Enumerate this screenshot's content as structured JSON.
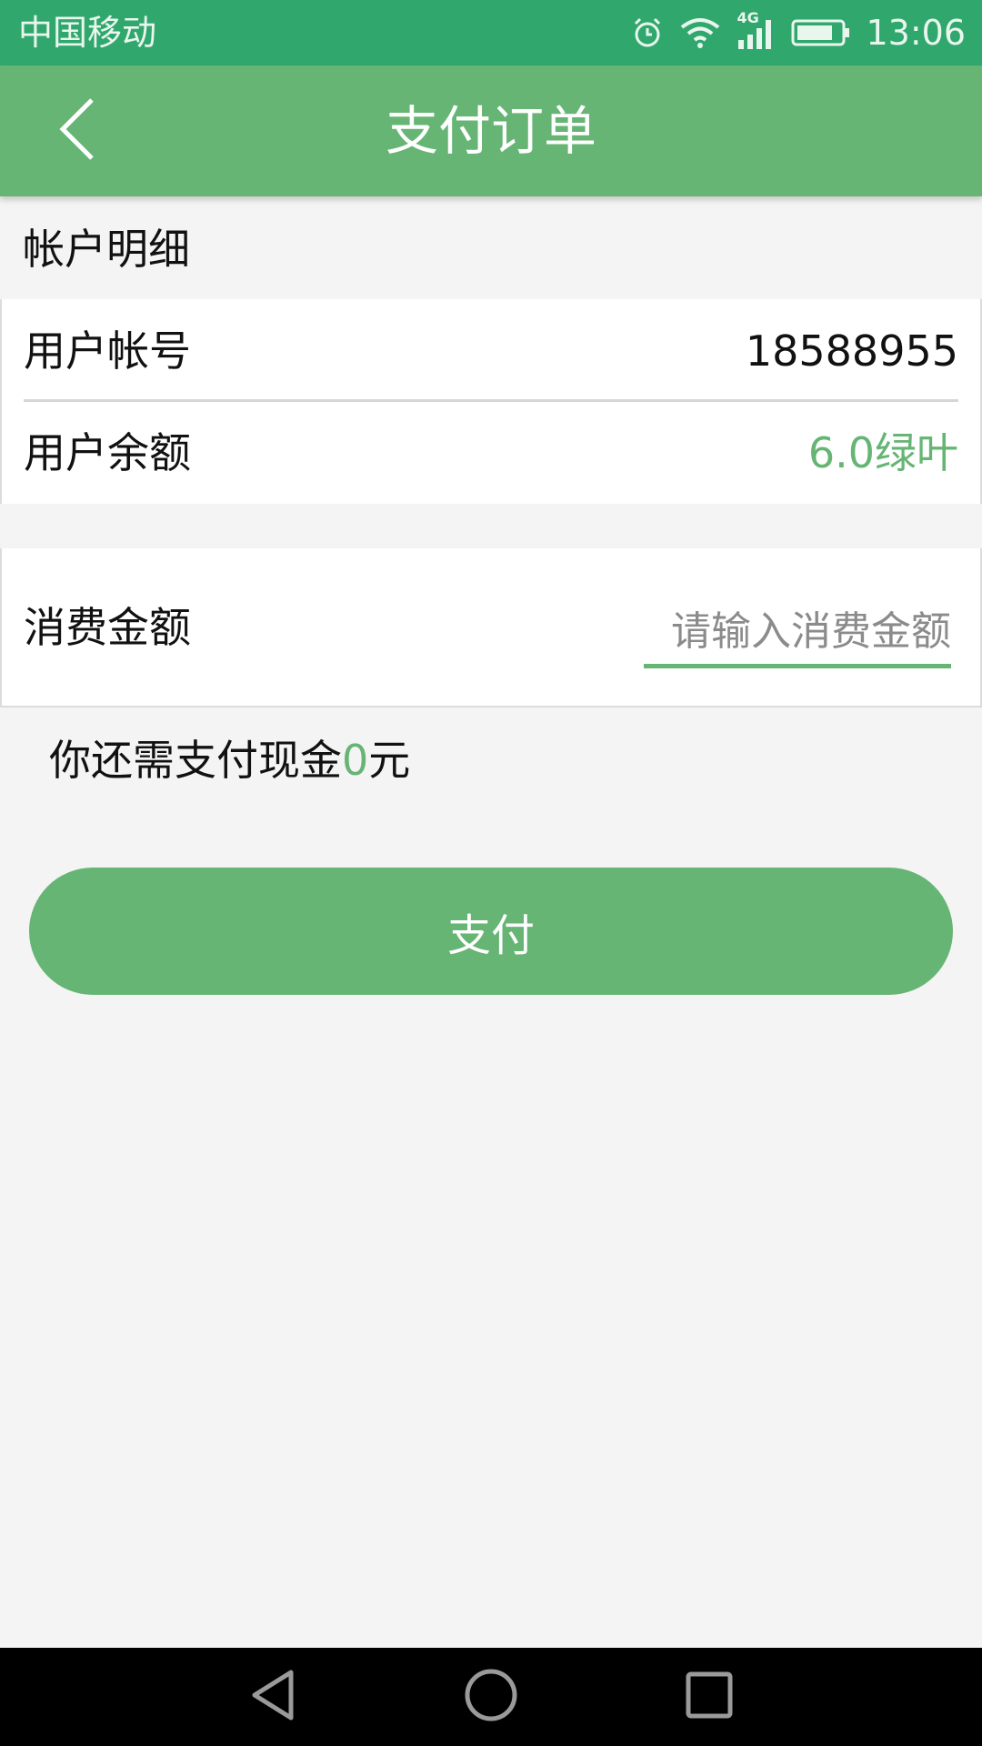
{
  "status_bar": {
    "carrier": "中国移动",
    "network": "4G",
    "time": "13:06",
    "icons": [
      "alarm-icon",
      "wifi-icon",
      "signal-icon",
      "battery-icon"
    ]
  },
  "app_bar": {
    "back_icon": "chevron-left-icon",
    "title": "支付订单"
  },
  "account_section": {
    "header": "帐户明细",
    "rows": [
      {
        "label": "用户帐号",
        "value": "18588955"
      },
      {
        "label": "用户余额",
        "value": "6.0绿叶"
      }
    ]
  },
  "amount_section": {
    "label": "消费金额",
    "input_value": "",
    "placeholder": "请输入消费金额"
  },
  "cash_due": {
    "prefix": "你还需支付现金",
    "amount": "0",
    "suffix": "元"
  },
  "pay_button": {
    "label": "支付"
  },
  "nav_bar": {
    "icons": [
      "back-triangle-icon",
      "home-circle-icon",
      "recents-square-icon"
    ]
  },
  "colors": {
    "status_bar": "#30a76d",
    "accent": "#66b574",
    "background": "#f4f4f4"
  }
}
